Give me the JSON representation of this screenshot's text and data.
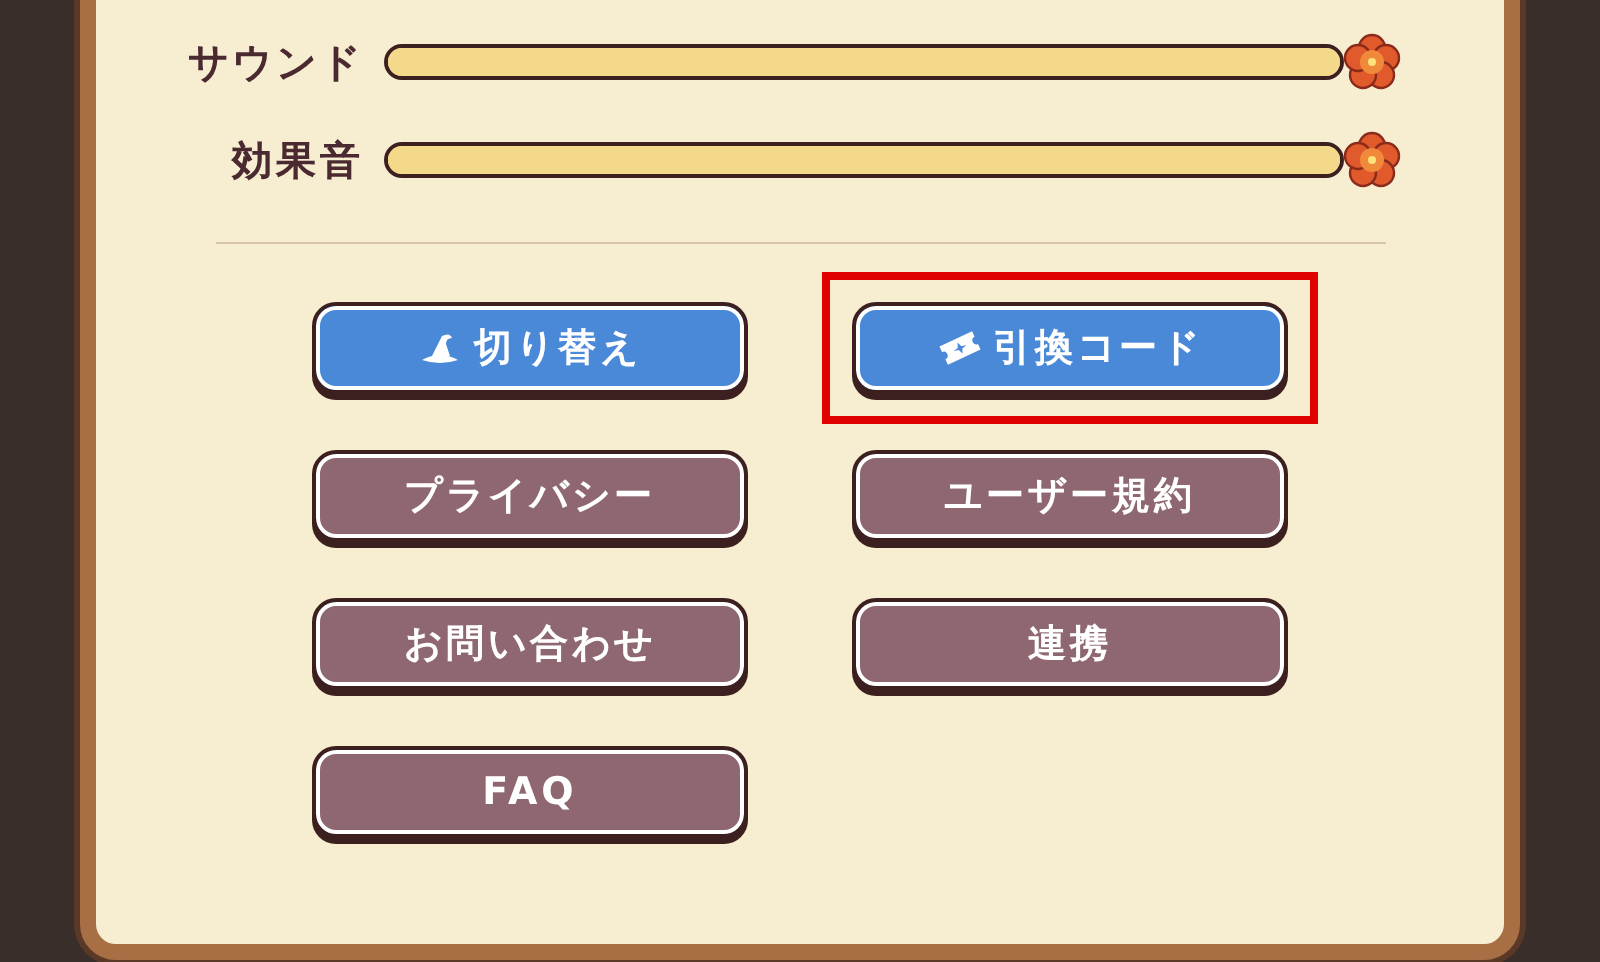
{
  "sliders": [
    {
      "label": "サウンド",
      "level": 1
    },
    {
      "label": "効果音",
      "level": 1
    }
  ],
  "buttons": [
    {
      "label": "切り替え",
      "kind": "primary",
      "highlighted": false
    },
    {
      "label": "引換コード",
      "kind": "primary",
      "highlighted": true
    },
    {
      "label": "プライバシー",
      "kind": "secondary",
      "highlighted": false
    },
    {
      "label": "ユーザー規約",
      "kind": "secondary",
      "highlighted": false
    },
    {
      "label": "お問い合わせ",
      "kind": "secondary",
      "highlighted": false
    },
    {
      "label": "連携",
      "kind": "secondary",
      "highlighted": false
    },
    {
      "label": "FAQ",
      "kind": "secondary",
      "highlighted": false
    }
  ]
}
